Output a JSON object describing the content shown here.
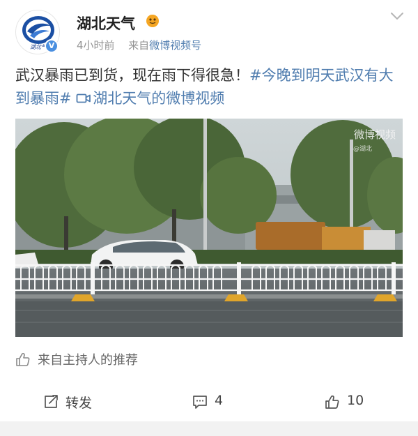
{
  "header": {
    "nickname": "湖北天气",
    "avatar_caption": "湖北气",
    "verified_mark": "V",
    "time": "4小时前",
    "source_prefix": "来自",
    "source_name": "微博视频号"
  },
  "post": {
    "text": "武汉暴雨已到货，现在雨下得很急！",
    "topic": "#今晚到明天武汉有大到暴雨#",
    "video_link": "湖北天气的微博视频"
  },
  "media": {
    "watermark": "微博视频",
    "watermark_sub": "@湖北"
  },
  "recommend": {
    "label": "来自主持人的推荐"
  },
  "actions": {
    "repost_label": "转发",
    "comment_count": "4",
    "like_count": "10"
  },
  "colors": {
    "link": "#507daf",
    "meta": "#939393"
  }
}
